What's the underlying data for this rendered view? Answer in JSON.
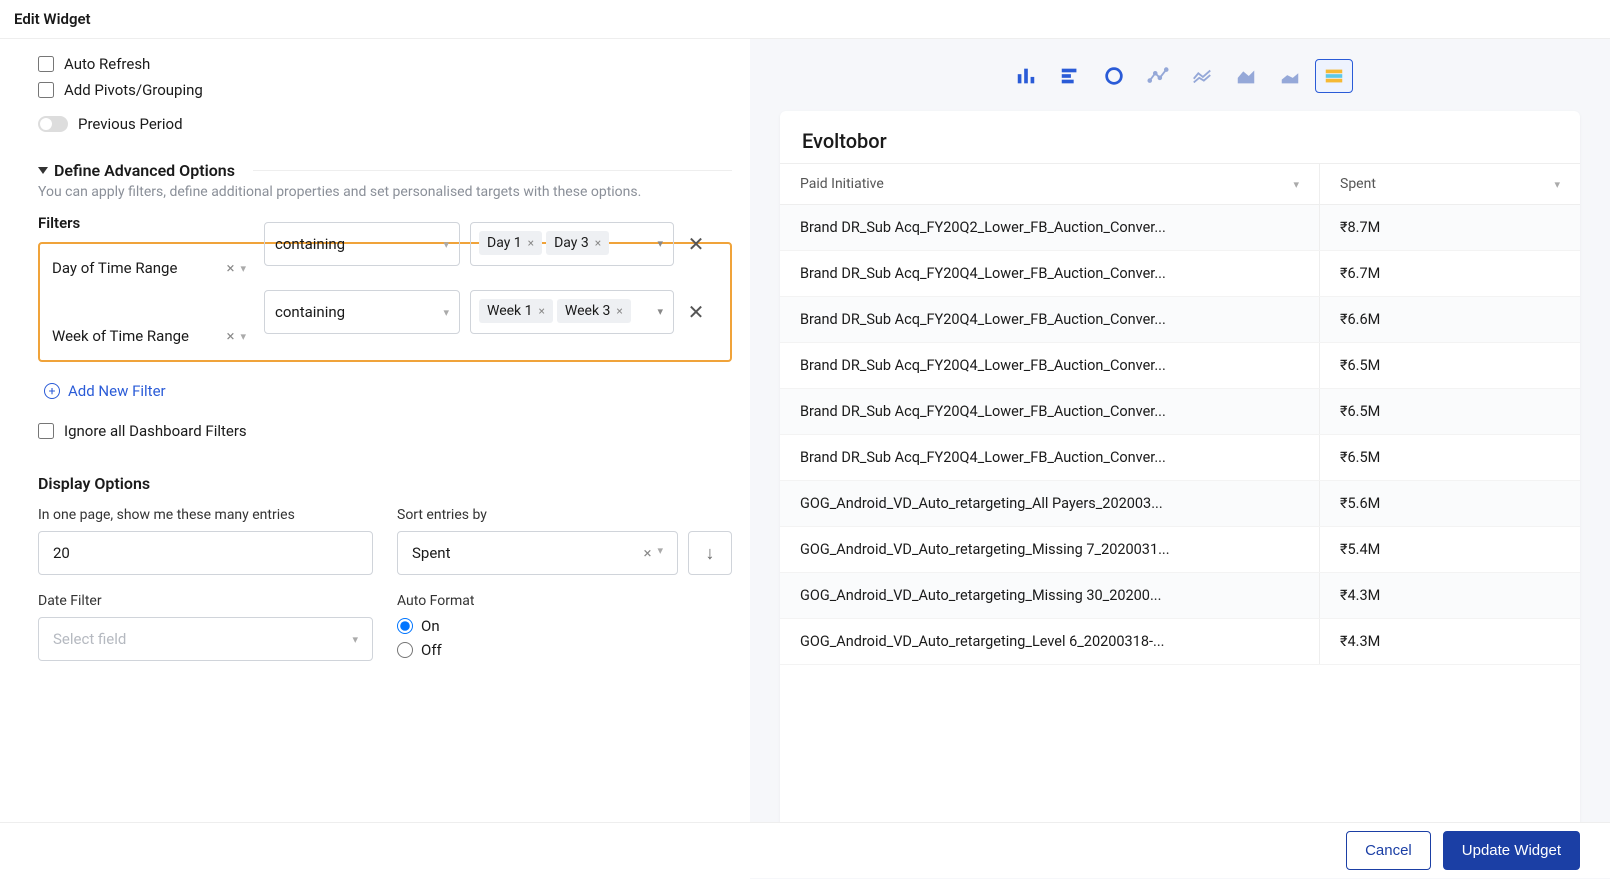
{
  "header": {
    "title": "Edit Widget"
  },
  "options": {
    "auto_refresh": "Auto Refresh",
    "add_pivots": "Add Pivots/Grouping",
    "previous_period": "Previous Period"
  },
  "advanced": {
    "title": "Define Advanced Options",
    "desc": "You can apply filters, define additional properties and set personalised targets with these options."
  },
  "filters": {
    "label": "Filters",
    "rows": [
      {
        "field": "Day of Time Range",
        "op": "containing",
        "values": [
          "Day 1",
          "Day 3"
        ]
      },
      {
        "field": "Week of Time Range",
        "op": "containing",
        "values": [
          "Week 1",
          "Week 3"
        ]
      }
    ],
    "add_label": "Add New Filter",
    "ignore_label": "Ignore all Dashboard Filters"
  },
  "display": {
    "title": "Display Options",
    "page_label": "In one page, show me these many entries",
    "page_value": "20",
    "sort_label": "Sort entries by",
    "sort_value": "Spent",
    "date_label": "Date Filter",
    "date_placeholder": "Select field",
    "autoformat_label": "Auto Format",
    "af_on": "On",
    "af_off": "Off"
  },
  "preview": {
    "title": "Evoltobor",
    "columns": [
      "Paid Initiative",
      "Spent"
    ],
    "rows": [
      {
        "c1": "Brand DR_Sub Acq_FY20Q2_Lower_FB_Auction_Conver...",
        "c2": "₹8.7M"
      },
      {
        "c1": "Brand DR_Sub Acq_FY20Q4_Lower_FB_Auction_Conver...",
        "c2": "₹6.7M"
      },
      {
        "c1": "Brand DR_Sub Acq_FY20Q4_Lower_FB_Auction_Conver...",
        "c2": "₹6.6M"
      },
      {
        "c1": "Brand DR_Sub Acq_FY20Q4_Lower_FB_Auction_Conver...",
        "c2": "₹6.5M"
      },
      {
        "c1": "Brand DR_Sub Acq_FY20Q4_Lower_FB_Auction_Conver...",
        "c2": "₹6.5M"
      },
      {
        "c1": "Brand DR_Sub Acq_FY20Q4_Lower_FB_Auction_Conver...",
        "c2": "₹6.5M"
      },
      {
        "c1": "GOG_Android_VD_Auto_retargeting_All Payers_202003...",
        "c2": "₹5.6M"
      },
      {
        "c1": "GOG_Android_VD_Auto_retargeting_Missing 7_2020031...",
        "c2": "₹5.4M"
      },
      {
        "c1": "GOG_Android_VD_Auto_retargeting_Missing 30_20200...",
        "c2": "₹4.3M"
      },
      {
        "c1": "GOG_Android_VD_Auto_retargeting_Level 6_20200318-...",
        "c2": "₹4.3M"
      }
    ]
  },
  "footer": {
    "cancel": "Cancel",
    "update": "Update Widget"
  }
}
